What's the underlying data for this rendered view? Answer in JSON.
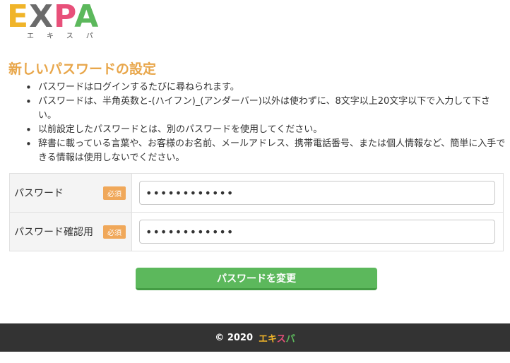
{
  "logo": {
    "letters": [
      "E",
      "X",
      "P",
      "A"
    ],
    "colors": [
      "#f0b429",
      "#6b6b6b",
      "#e8507a",
      "#5cb85c"
    ],
    "kana": "エキスパ"
  },
  "page_title": "新しいパスワードの設定",
  "notes": [
    "パスワードはログインするたびに尋ねられます。",
    "パスワードは、半角英数と-(ハイフン)_(アンダーバー)以外は使わずに、8文字以上20文字以下で入力して下さい。",
    "以前設定したパスワードとは、別のパスワードを使用してください。",
    "辞書に載っている言葉や、お客様のお名前、メールアドレス、携帯電話番号、または個人情報など、簡単に入手できる情報は使用しないでください。"
  ],
  "form": {
    "password_label": "パスワード",
    "confirm_label": "パスワード確認用",
    "required_badge": "必須",
    "password_value": "••••••••••••",
    "confirm_value": "••••••••••••"
  },
  "submit_label": "パスワードを変更",
  "footer": {
    "copyright": "© 2020",
    "brand_chars": [
      "エ",
      "キ",
      "ス",
      "パ"
    ],
    "brand_colors": [
      "#f0b429",
      "#f0b429",
      "#e8507a",
      "#5cb85c"
    ]
  }
}
